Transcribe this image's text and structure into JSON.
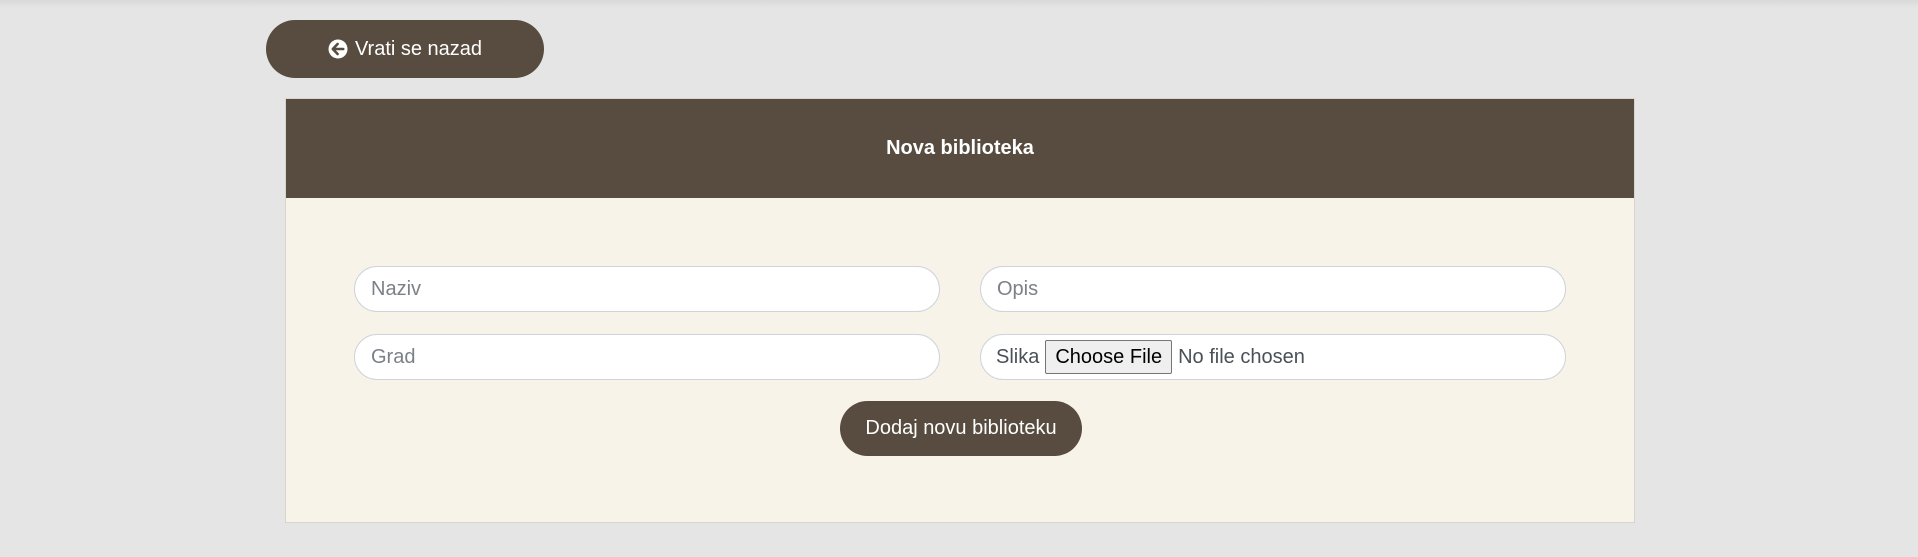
{
  "nav": {
    "back_label": "Vrati se nazad",
    "back_icon": "arrow-circle-left-icon"
  },
  "form": {
    "title": "Nova biblioteka",
    "naziv_placeholder": "Naziv",
    "opis_placeholder": "Opis",
    "grad_placeholder": "Grad",
    "slika_label": "Slika",
    "choose_file_label": "Choose File",
    "no_file_text": "No file chosen",
    "submit_label": "Dodaj novu biblioteku"
  },
  "colors": {
    "page_bg": "#e5e5e5",
    "brand_brown": "#584b3f",
    "card_bg": "#f8f3e8"
  }
}
